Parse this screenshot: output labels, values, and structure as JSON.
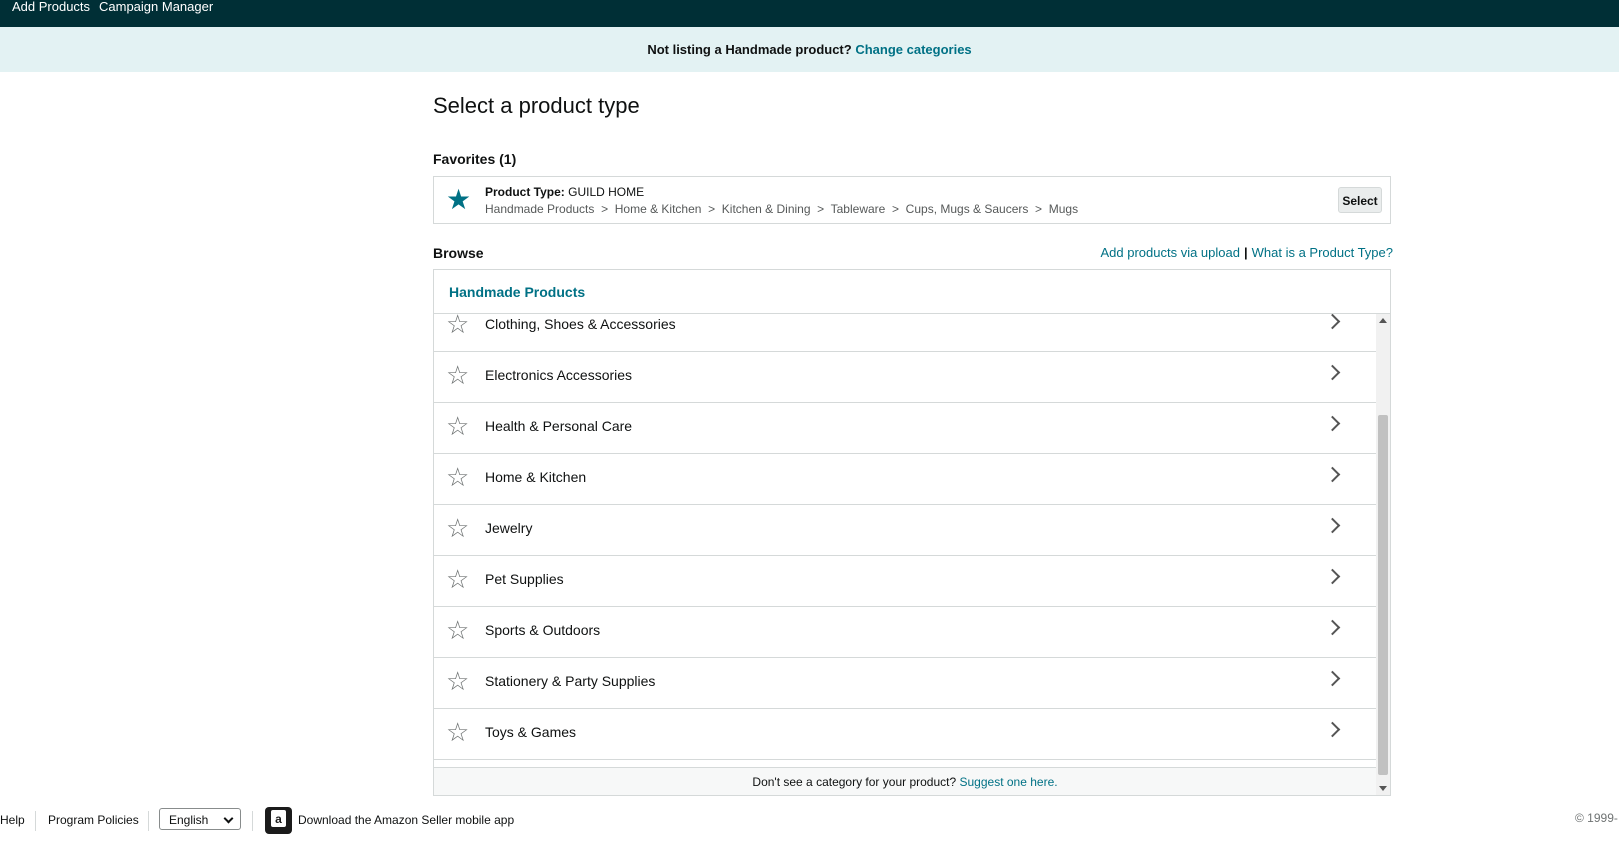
{
  "topnav": {
    "items": [
      "Add Products",
      "Campaign Manager"
    ]
  },
  "banner": {
    "text": "Not listing a Handmade product?",
    "link": "Change categories"
  },
  "page_title": "Select a product type",
  "favorites": {
    "label": "Favorites (1)",
    "item": {
      "type_label": "Product Type:",
      "type_value": "GUILD HOME",
      "path": "Handmade Products  >  Home & Kitchen  >  Kitchen & Dining  >  Tableware  >  Cups, Mugs & Saucers  >  Mugs",
      "select_label": "Select",
      "icon": "star-filled-icon"
    }
  },
  "browse": {
    "label": "Browse",
    "upload_link": "Add products via upload",
    "separator": "|",
    "what_link": "What is a Product Type?",
    "header": "Handmade Products",
    "categories": [
      "Clothing, Shoes & Accessories",
      "Electronics Accessories",
      "Health & Personal Care",
      "Home & Kitchen",
      "Jewelry",
      "Pet Supplies",
      "Sports & Outdoors",
      "Stationery & Party Supplies",
      "Toys & Games"
    ],
    "suggest_text": "Don't see a category for your product?",
    "suggest_link": "Suggest one here."
  },
  "footer": {
    "help": "Help",
    "policies": "Program Policies",
    "language": "English",
    "app_text": "Download the Amazon Seller mobile app",
    "app_icon_letter": "a",
    "copyright": "© 1999-"
  },
  "colors": {
    "nav_bg": "#002f36",
    "banner_bg": "#e3f2f3",
    "link": "#007185"
  }
}
